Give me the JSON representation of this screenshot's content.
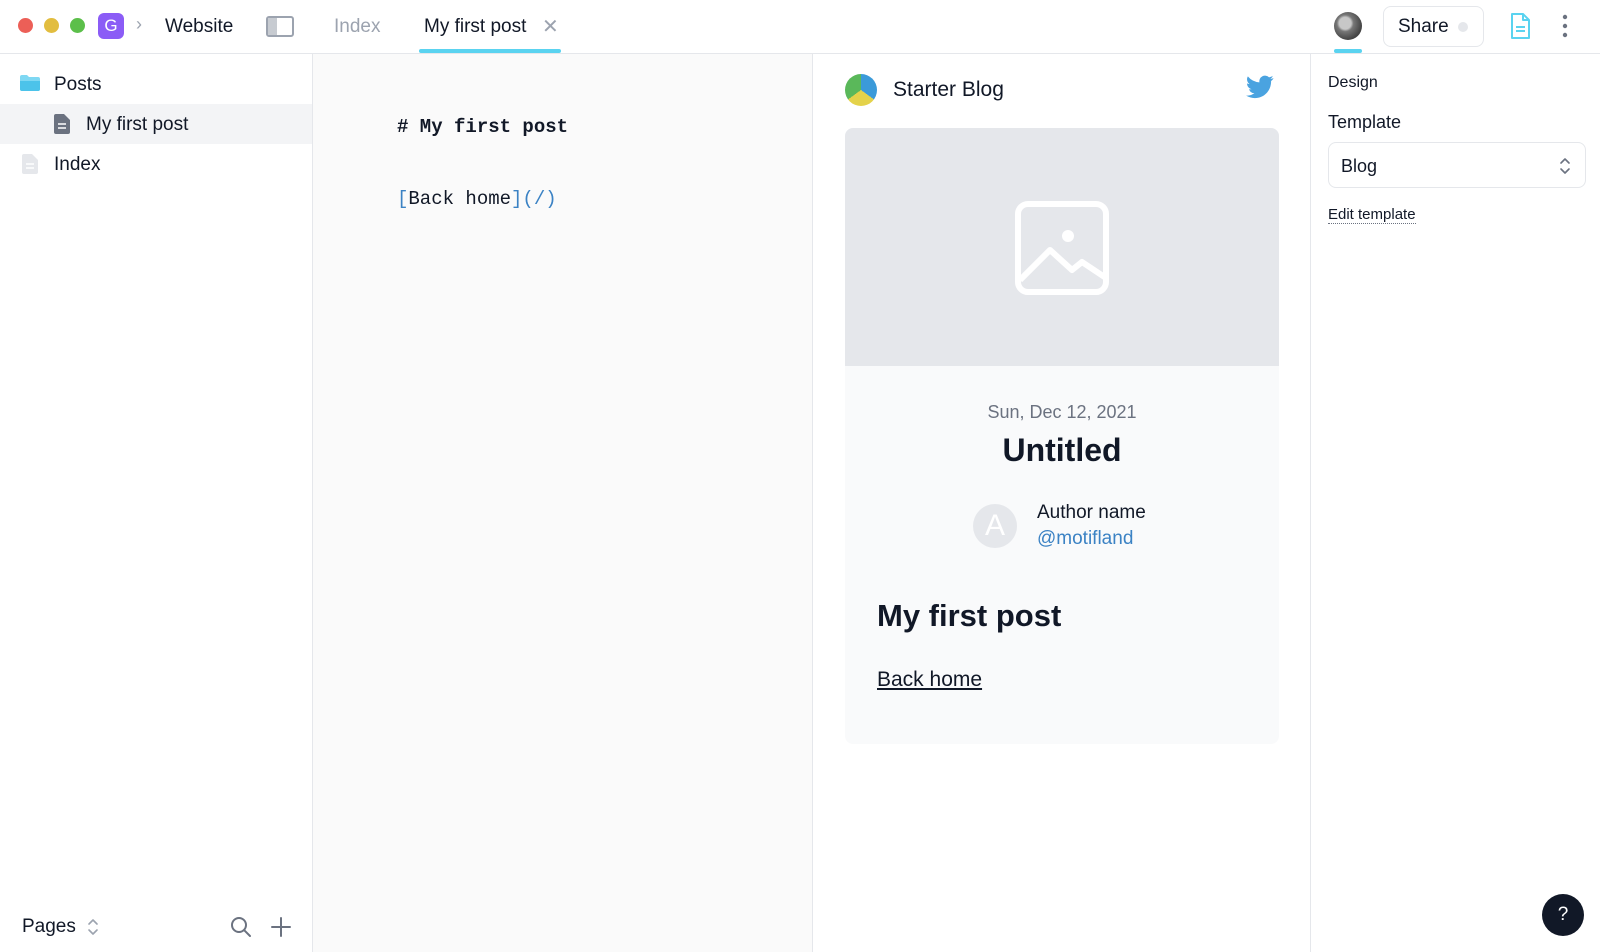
{
  "header": {
    "workspace_initial": "G",
    "workspace_name": "Website",
    "tabs": [
      {
        "label": "Index",
        "active": false
      },
      {
        "label": "My first post",
        "active": true
      }
    ],
    "share_label": "Share",
    "accent_color": "#5ad3f0"
  },
  "sidebar": {
    "items": [
      {
        "label": "Posts",
        "icon": "folder-icon"
      },
      {
        "label": "My first post",
        "icon": "file-icon"
      },
      {
        "label": "Index",
        "icon": "file-icon"
      }
    ],
    "footer_label": "Pages"
  },
  "editor": {
    "heading_line": "# My first post",
    "link_text": "Back home",
    "link_target": "/"
  },
  "preview": {
    "blog_name": "Starter Blog",
    "post_date": "Sun, Dec 12, 2021",
    "post_title": "Untitled",
    "author_initial": "A",
    "author_name": "Author name",
    "author_handle": "@motifland",
    "content_heading": "My first post",
    "content_link": "Back home"
  },
  "design_panel": {
    "title": "Design",
    "template_label": "Template",
    "template_value": "Blog",
    "edit_template_label": "Edit template"
  },
  "help": {
    "label": "?"
  }
}
